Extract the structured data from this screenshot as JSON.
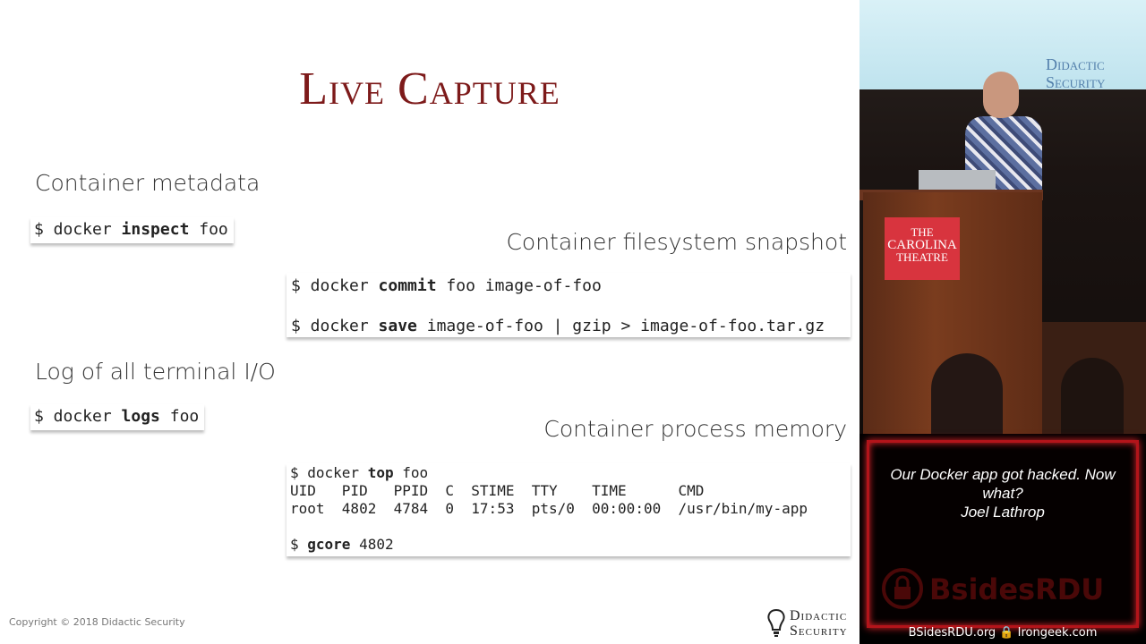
{
  "slide": {
    "title": "Live Capture",
    "section_metadata": "Container metadata",
    "cmd_inspect": [
      "$ docker ",
      "inspect",
      " foo"
    ],
    "section_snapshot": "Container filesystem snapshot",
    "cmd_commit": [
      "$ docker ",
      "commit",
      " foo image-of-foo"
    ],
    "cmd_save": [
      "$ docker ",
      "save",
      " image-of-foo | gzip > image-of-foo.tar.gz"
    ],
    "section_log": "Log of all terminal I/O",
    "cmd_logs": [
      "$ docker ",
      "logs",
      " foo"
    ],
    "section_memory": "Container process memory",
    "cmd_top": [
      "$ docker ",
      "top",
      " foo"
    ],
    "top_header": "UID   PID   PPID  C  STIME  TTY    TIME      CMD",
    "top_row": "root  4802  4784  0  17:53  pts/0  00:00:00  /usr/bin/my-app",
    "cmd_gcore": [
      "$ ",
      "gcore",
      " 4802"
    ],
    "copyright": "Copyright © 2018 Didactic Security",
    "logo_line1": "Didactic",
    "logo_line2": "Security"
  },
  "video": {
    "backdrop_logo_line1": "Didactic",
    "backdrop_logo_line2": "Security",
    "podium_sign": [
      "THE",
      "CAROLINA",
      "THEATRE"
    ]
  },
  "overlay": {
    "talk_title": "Our Docker app got hacked. Now what?",
    "speaker": "Joel Lathrop",
    "event_logo": "BsidesRDU",
    "footer": "BSidesRDU.org 🔒 Irongeek.com"
  },
  "colors": {
    "title": "#7d1a1a",
    "overlay_border": "#b3141a",
    "podium_sign": "#d8343e"
  }
}
